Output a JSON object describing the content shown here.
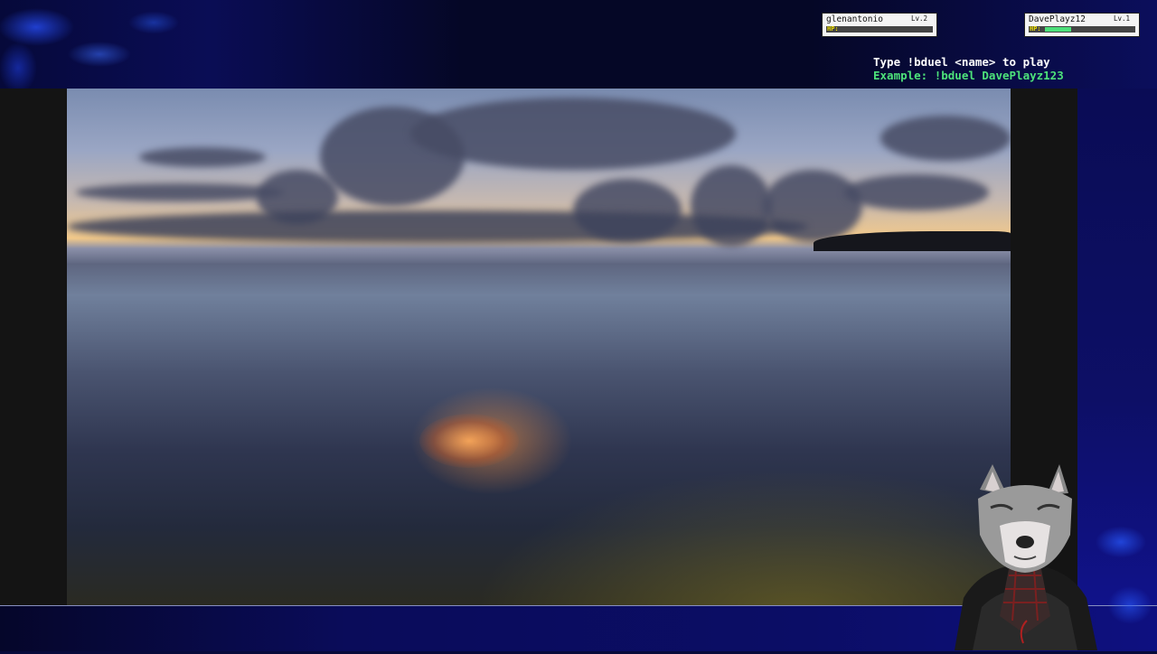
{
  "players": [
    {
      "name": "glenantonio",
      "level": "Lv.2",
      "hp_label": "HP:",
      "hp_fraction": 0.0
    },
    {
      "name": "DavePlayz12",
      "level": "Lv.1",
      "hp_label": "HP:",
      "hp_fraction": 0.3
    }
  ],
  "instructions": {
    "line1": "Type !bduel <name> to play",
    "line2": "Example: !bduel DavePlayz123"
  },
  "colors": {
    "background": "#070a3a",
    "instruction_text": "#ffffff",
    "example_text": "#4de27a",
    "hp_fill": "#4de07a",
    "hp_label": "#f0e000"
  },
  "icons": {
    "avatar": "wolf-avatar-icon"
  }
}
